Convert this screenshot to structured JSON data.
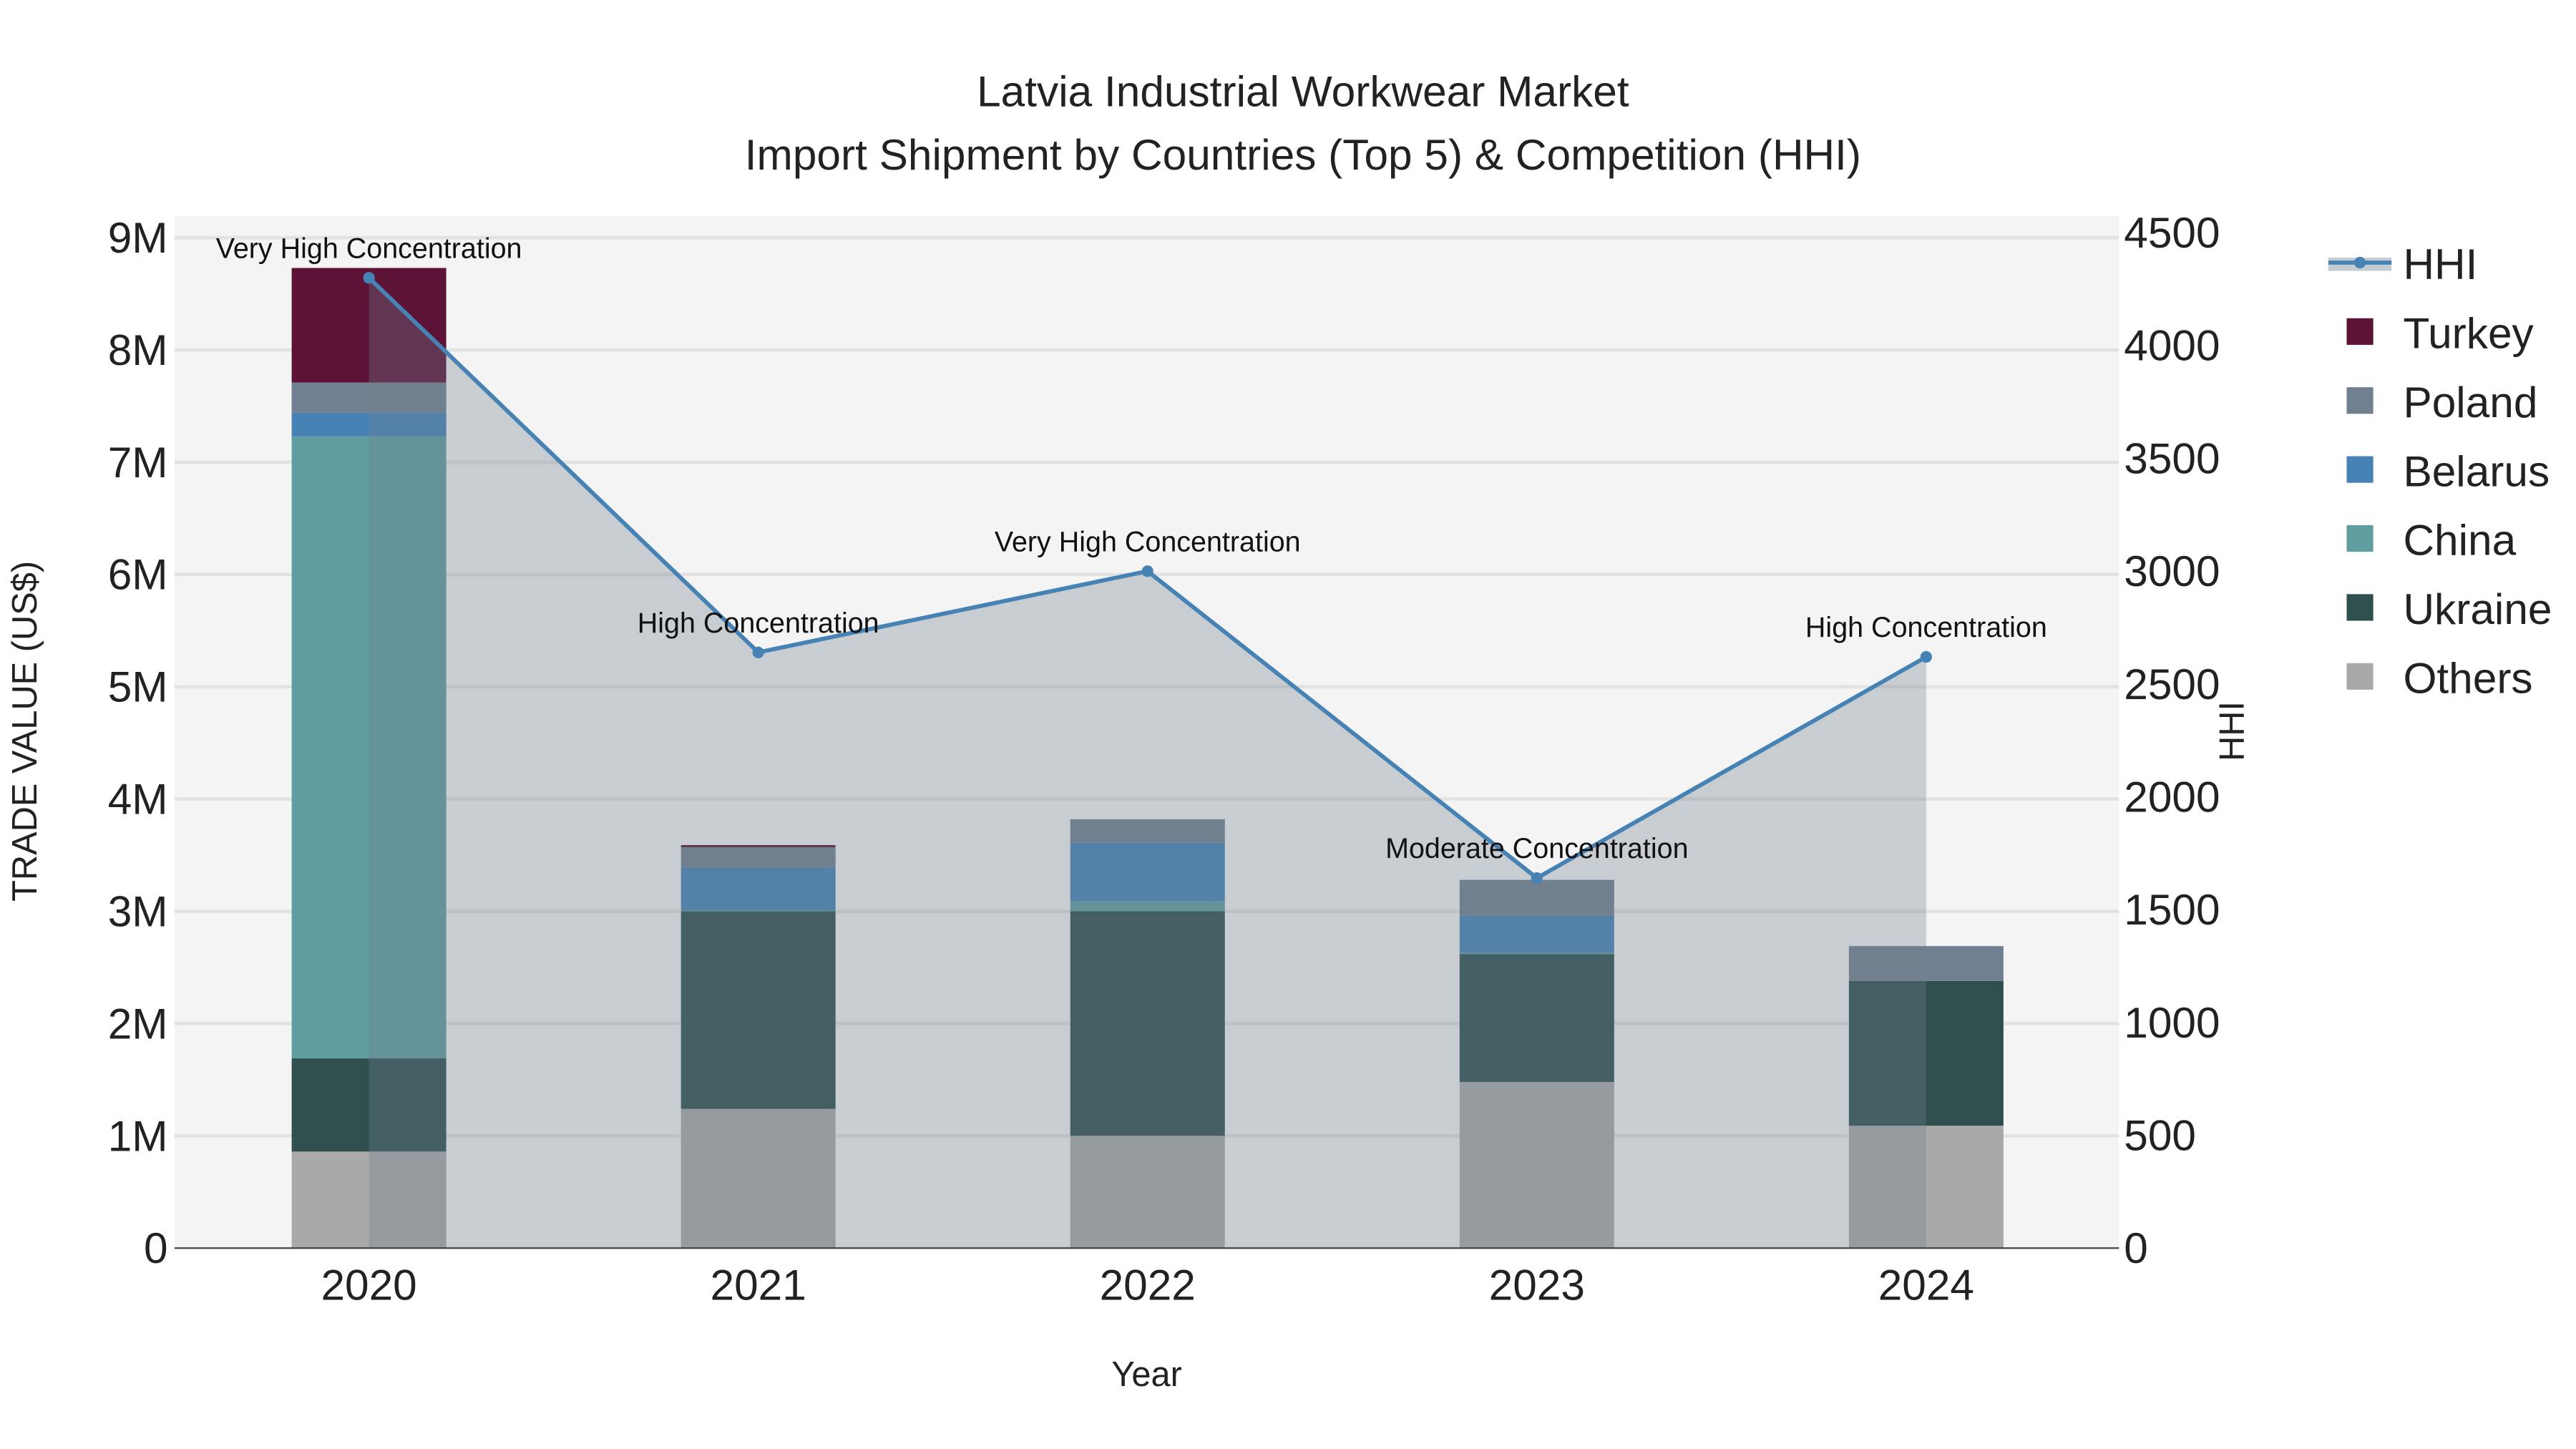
{
  "chart_data": {
    "type": "bar",
    "title_line1": "Latvia Industrial Workwear Market",
    "title_line2": "Import Shipment by Countries (Top 5) & Competition (HHI)",
    "xlabel": "Year",
    "ylabel": "TRADE VALUE (US$)",
    "y2label": "HHI",
    "categories": [
      "2020",
      "2021",
      "2022",
      "2023",
      "2024"
    ],
    "ylim": [
      0,
      9000000
    ],
    "y2lim": [
      0,
      4500
    ],
    "yticks": [
      {
        "v": 0,
        "label": "0"
      },
      {
        "v": 1000000,
        "label": "1M"
      },
      {
        "v": 2000000,
        "label": "2M"
      },
      {
        "v": 3000000,
        "label": "3M"
      },
      {
        "v": 4000000,
        "label": "4M"
      },
      {
        "v": 5000000,
        "label": "5M"
      },
      {
        "v": 6000000,
        "label": "6M"
      },
      {
        "v": 7000000,
        "label": "7M"
      },
      {
        "v": 8000000,
        "label": "8M"
      },
      {
        "v": 9000000,
        "label": "9M"
      }
    ],
    "y2ticks": [
      {
        "v": 0,
        "label": "0"
      },
      {
        "v": 500,
        "label": "500"
      },
      {
        "v": 1000,
        "label": "1000"
      },
      {
        "v": 1500,
        "label": "1500"
      },
      {
        "v": 2000,
        "label": "2000"
      },
      {
        "v": 2500,
        "label": "2500"
      },
      {
        "v": 3000,
        "label": "3000"
      },
      {
        "v": 3500,
        "label": "3500"
      },
      {
        "v": 4000,
        "label": "4000"
      },
      {
        "v": 4500,
        "label": "4500"
      }
    ],
    "grid": true,
    "legend_position": "right",
    "series": [
      {
        "name": "Others",
        "color": "#a9a9a9",
        "values": [
          860000,
          1240000,
          1000000,
          1480000,
          1090000
        ]
      },
      {
        "name": "Ukraine",
        "color": "#2f4f4f",
        "values": [
          830000,
          1760000,
          2000000,
          1140000,
          1290000
        ]
      },
      {
        "name": "China",
        "color": "#5f9ea0",
        "values": [
          5540000,
          10000,
          90000,
          10000,
          0
        ]
      },
      {
        "name": "Belarus",
        "color": "#4682b4",
        "values": [
          210000,
          380000,
          520000,
          330000,
          0
        ]
      },
      {
        "name": "Poland",
        "color": "#708090",
        "values": [
          270000,
          180000,
          210000,
          320000,
          310000
        ]
      },
      {
        "name": "Turkey",
        "color": "#5c1335",
        "values": [
          1020000,
          20000,
          0,
          0,
          0
        ]
      }
    ],
    "hhi": {
      "name": "HHI",
      "color": "#4682b4",
      "values": [
        4300,
        2640,
        3000,
        1640,
        2620
      ],
      "annotations": [
        "Very High Concentration",
        "High Concentration",
        "Very High Concentration",
        "Moderate Concentration",
        "High Concentration"
      ]
    },
    "legend_order": [
      "HHI",
      "Turkey",
      "Poland",
      "Belarus",
      "China",
      "Ukraine",
      "Others"
    ]
  }
}
